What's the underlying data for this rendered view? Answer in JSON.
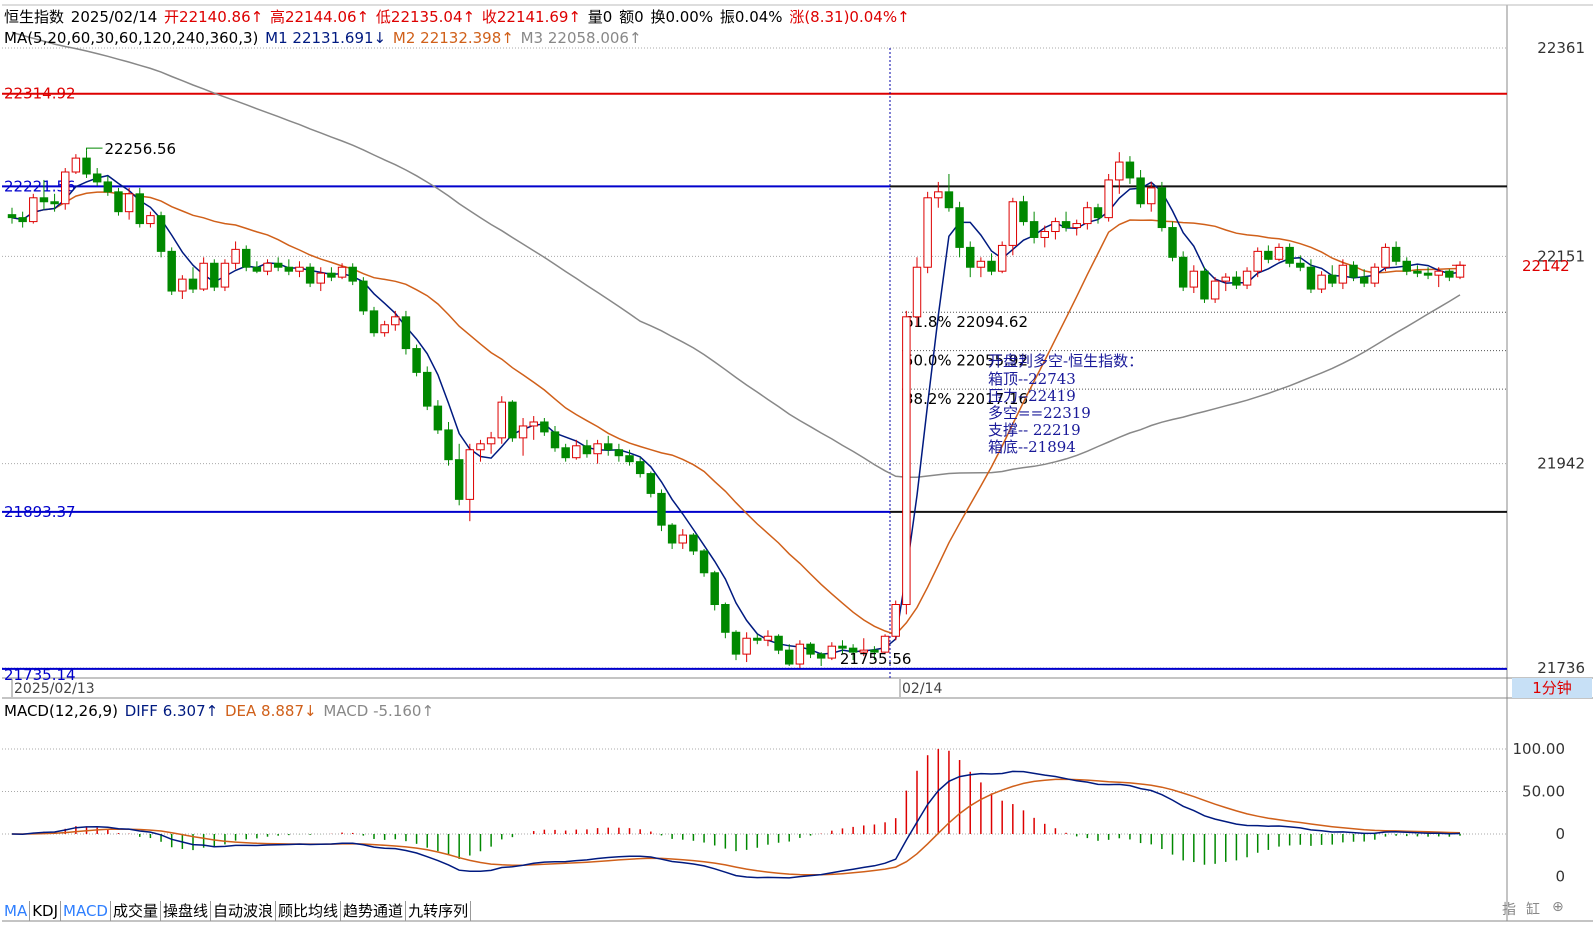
{
  "header": {
    "name": "恒生指数",
    "date": "2025/02/14",
    "open": "开22140.86↑",
    "high": "高22144.06↑",
    "low": "低22135.04↑",
    "close": "收22141.69↑",
    "volume": "量0",
    "amount": "额0",
    "turnover": "换0.00%",
    "amplitude": "振0.04%",
    "change": "涨(8.31)0.04%↑"
  },
  "ma_line": {
    "label": "MA(5,20,60,30,60,120,240,360,3)",
    "m1": "M1 22131.691↓",
    "m2": "M2 22132.398↑",
    "m3": "M3 22058.006↑"
  },
  "macd_line": {
    "label": "MACD(12,26,9)",
    "diff": "DIFF 6.307↑",
    "dea": "DEA 8.887↓",
    "macd": "MACD -5.160↑"
  },
  "price_axis": [
    "22361",
    "22151",
    "21942",
    "21736"
  ],
  "current_price": "22142",
  "macd_axis": [
    "100.00",
    "50.00",
    "0",
    "0"
  ],
  "time_axis": [
    "2025/02/13",
    "02/14"
  ],
  "period": "1分钟",
  "h_levels": [
    {
      "value": "22314.92",
      "price": 22314.92,
      "color": "#dd0000"
    },
    {
      "value": "22221.56",
      "price": 22221.56,
      "color": "#0000cc"
    },
    {
      "value": "21893.37",
      "price": 21893.37,
      "color": "#0000cc"
    },
    {
      "value": "21735.14",
      "price": 21735.14,
      "color": "#0000cc"
    }
  ],
  "right_levels": [
    22221.56,
    21893.37
  ],
  "extremes": {
    "high": "22256.56",
    "low": "21755.56"
  },
  "fib": [
    {
      "label": "61.8% 22094.62",
      "price": 22094.62
    },
    {
      "label": "50.0% 22055.92",
      "price": 22055.92
    },
    {
      "label": "38.2% 22017.16",
      "price": 22017.16
    }
  ],
  "annotation": [
    "开盘判多空-恒生指数：",
    "箱顶--22743",
    "压力--22419",
    "多空==22319",
    "支撑--  22219",
    "箱底--21894"
  ],
  "tabs": [
    "MA",
    "KDJ",
    "MACD",
    "成交量",
    "操盘线",
    "自动波浪",
    "顾比均线",
    "趋势通道",
    "九转序列"
  ],
  "active_tabs": [
    "MA",
    "MACD"
  ],
  "bottom_right": [
    "指",
    "缸"
  ],
  "colors": {
    "up": "#dd0000",
    "down": "#008800",
    "m1": "#001a80",
    "m2": "#d0601a",
    "m3": "#888888",
    "box": "#0000cc",
    "resist": "#dd0000"
  },
  "chart_data": {
    "type": "candlestick",
    "ylim": [
      21736,
      22361
    ],
    "series_ohlc": [
      [
        22193,
        22200,
        22184,
        22190
      ],
      [
        22190,
        22196,
        22180,
        22186
      ],
      [
        22186,
        22214,
        22184,
        22210
      ],
      [
        22210,
        22228,
        22198,
        22206
      ],
      [
        22206,
        22214,
        22196,
        22204
      ],
      [
        22204,
        22240,
        22198,
        22236
      ],
      [
        22236,
        22254,
        22234,
        22250
      ],
      [
        22250,
        22258,
        22230,
        22234
      ],
      [
        22234,
        22240,
        22222,
        22226
      ],
      [
        22226,
        22232,
        22212,
        22216
      ],
      [
        22216,
        22220,
        22192,
        22196
      ],
      [
        22196,
        22220,
        22188,
        22214
      ],
      [
        22214,
        22220,
        22180,
        22184
      ],
      [
        22184,
        22196,
        22180,
        22192
      ],
      [
        22192,
        22196,
        22150,
        22156
      ],
      [
        22156,
        22160,
        22112,
        22116
      ],
      [
        22116,
        22132,
        22108,
        22128
      ],
      [
        22128,
        22140,
        22114,
        22118
      ],
      [
        22118,
        22150,
        22116,
        22144
      ],
      [
        22144,
        22148,
        22116,
        22120
      ],
      [
        22120,
        22148,
        22116,
        22144
      ],
      [
        22144,
        22166,
        22138,
        22158
      ],
      [
        22158,
        22162,
        22136,
        22140
      ],
      [
        22140,
        22146,
        22134,
        22136
      ],
      [
        22136,
        22148,
        22132,
        22144
      ],
      [
        22144,
        22150,
        22136,
        22140
      ],
      [
        22140,
        22148,
        22132,
        22136
      ],
      [
        22136,
        22146,
        22130,
        22140
      ],
      [
        22140,
        22144,
        22120,
        22124
      ],
      [
        22124,
        22140,
        22116,
        22134
      ],
      [
        22134,
        22140,
        22126,
        22130
      ],
      [
        22130,
        22144,
        22128,
        22140
      ],
      [
        22140,
        22144,
        22122,
        22126
      ],
      [
        22126,
        22130,
        22092,
        22096
      ],
      [
        22096,
        22100,
        22070,
        22074
      ],
      [
        22074,
        22086,
        22070,
        22082
      ],
      [
        22082,
        22096,
        22076,
        22090
      ],
      [
        22090,
        22096,
        22052,
        22058
      ],
      [
        22058,
        22062,
        22030,
        22034
      ],
      [
        22034,
        22040,
        21996,
        22000
      ],
      [
        22000,
        22006,
        21972,
        21976
      ],
      [
        21976,
        21984,
        21940,
        21946
      ],
      [
        21946,
        21962,
        21900,
        21906
      ],
      [
        21906,
        21962,
        21884,
        21956
      ],
      [
        21956,
        21966,
        21944,
        21962
      ],
      [
        21962,
        21974,
        21952,
        21968
      ],
      [
        21968,
        22010,
        21962,
        22004
      ],
      [
        22004,
        22006,
        21964,
        21968
      ],
      [
        21968,
        21988,
        21950,
        21980
      ],
      [
        21980,
        21990,
        21966,
        21984
      ],
      [
        21984,
        21988,
        21970,
        21974
      ],
      [
        21974,
        21980,
        21954,
        21958
      ],
      [
        21958,
        21962,
        21944,
        21948
      ],
      [
        21948,
        21966,
        21946,
        21960
      ],
      [
        21960,
        21966,
        21948,
        21952
      ],
      [
        21952,
        21966,
        21942,
        21962
      ],
      [
        21962,
        21970,
        21950,
        21956
      ],
      [
        21956,
        21962,
        21944,
        21950
      ],
      [
        21950,
        21956,
        21940,
        21944
      ],
      [
        21944,
        21948,
        21928,
        21932
      ],
      [
        21932,
        21934,
        21908,
        21912
      ],
      [
        21912,
        21916,
        21874,
        21880
      ],
      [
        21880,
        21882,
        21856,
        21862
      ],
      [
        21862,
        21876,
        21856,
        21870
      ],
      [
        21870,
        21872,
        21850,
        21854
      ],
      [
        21854,
        21856,
        21828,
        21832
      ],
      [
        21832,
        21834,
        21794,
        21800
      ],
      [
        21800,
        21802,
        21766,
        21772
      ],
      [
        21772,
        21774,
        21744,
        21750
      ],
      [
        21750,
        21772,
        21742,
        21766
      ],
      [
        21766,
        21770,
        21760,
        21764
      ],
      [
        21764,
        21774,
        21758,
        21768
      ],
      [
        21768,
        21770,
        21750,
        21754
      ],
      [
        21754,
        21760,
        21738,
        21740
      ],
      [
        21740,
        21764,
        21736,
        21760
      ],
      [
        21760,
        21762,
        21746,
        21750
      ],
      [
        21750,
        21752,
        21738,
        21746
      ],
      [
        21746,
        21762,
        21744,
        21758
      ],
      [
        21758,
        21764,
        21750,
        21756
      ],
      [
        21756,
        21760,
        21744,
        21752
      ],
      [
        21752,
        21766,
        21748,
        21754
      ],
      [
        21754,
        21758,
        21744,
        21752
      ],
      [
        21752,
        21770,
        21750,
        21768
      ],
      [
        21768,
        21804,
        21764,
        21800
      ],
      [
        21800,
        22096,
        21790,
        22090
      ],
      [
        22090,
        22150,
        22080,
        22140
      ],
      [
        22140,
        22216,
        22134,
        22210
      ],
      [
        22210,
        22226,
        22200,
        22216
      ],
      [
        22216,
        22234,
        22196,
        22200
      ],
      [
        22200,
        22206,
        22150,
        22160
      ],
      [
        22160,
        22166,
        22130,
        22140
      ],
      [
        22140,
        22150,
        22130,
        22146
      ],
      [
        22146,
        22154,
        22132,
        22136
      ],
      [
        22136,
        22166,
        22134,
        22162
      ],
      [
        22162,
        22210,
        22152,
        22206
      ],
      [
        22206,
        22212,
        22182,
        22186
      ],
      [
        22186,
        22196,
        22164,
        22170
      ],
      [
        22170,
        22182,
        22160,
        22176
      ],
      [
        22176,
        22190,
        22168,
        22186
      ],
      [
        22186,
        22196,
        22176,
        22180
      ],
      [
        22180,
        22188,
        22172,
        22184
      ],
      [
        22184,
        22206,
        22178,
        22200
      ],
      [
        22200,
        22204,
        22184,
        22190
      ],
      [
        22190,
        22234,
        22186,
        22228
      ],
      [
        22228,
        22256,
        22214,
        22246
      ],
      [
        22246,
        22252,
        22224,
        22230
      ],
      [
        22230,
        22238,
        22200,
        22204
      ],
      [
        22204,
        22226,
        22196,
        22220
      ],
      [
        22220,
        22226,
        22176,
        22180
      ],
      [
        22180,
        22186,
        22146,
        22150
      ],
      [
        22150,
        22156,
        22116,
        22120
      ],
      [
        22120,
        22142,
        22114,
        22136
      ],
      [
        22136,
        22140,
        22104,
        22108
      ],
      [
        22108,
        22130,
        22104,
        22126
      ],
      [
        22126,
        22134,
        22116,
        22130
      ],
      [
        22130,
        22136,
        22118,
        22122
      ],
      [
        22122,
        22140,
        22118,
        22136
      ],
      [
        22136,
        22160,
        22130,
        22156
      ],
      [
        22156,
        22162,
        22144,
        22148
      ],
      [
        22148,
        22164,
        22146,
        22160
      ],
      [
        22160,
        22164,
        22140,
        22144
      ],
      [
        22144,
        22152,
        22136,
        22140
      ],
      [
        22140,
        22148,
        22114,
        22118
      ],
      [
        22118,
        22136,
        22114,
        22132
      ],
      [
        22132,
        22142,
        22120,
        22124
      ],
      [
        22124,
        22148,
        22118,
        22142
      ],
      [
        22142,
        22146,
        22126,
        22130
      ],
      [
        22130,
        22138,
        22120,
        22124
      ],
      [
        22124,
        22144,
        22120,
        22140
      ],
      [
        22140,
        22164,
        22136,
        22160
      ],
      [
        22160,
        22166,
        22142,
        22146
      ],
      [
        22146,
        22150,
        22132,
        22136
      ],
      [
        22136,
        22142,
        22130,
        22134
      ],
      [
        22134,
        22140,
        22128,
        22132
      ],
      [
        22132,
        22140,
        22120,
        22136
      ],
      [
        22136,
        22138,
        22126,
        22130
      ],
      [
        22130,
        22146,
        22128,
        22142
      ]
    ]
  }
}
